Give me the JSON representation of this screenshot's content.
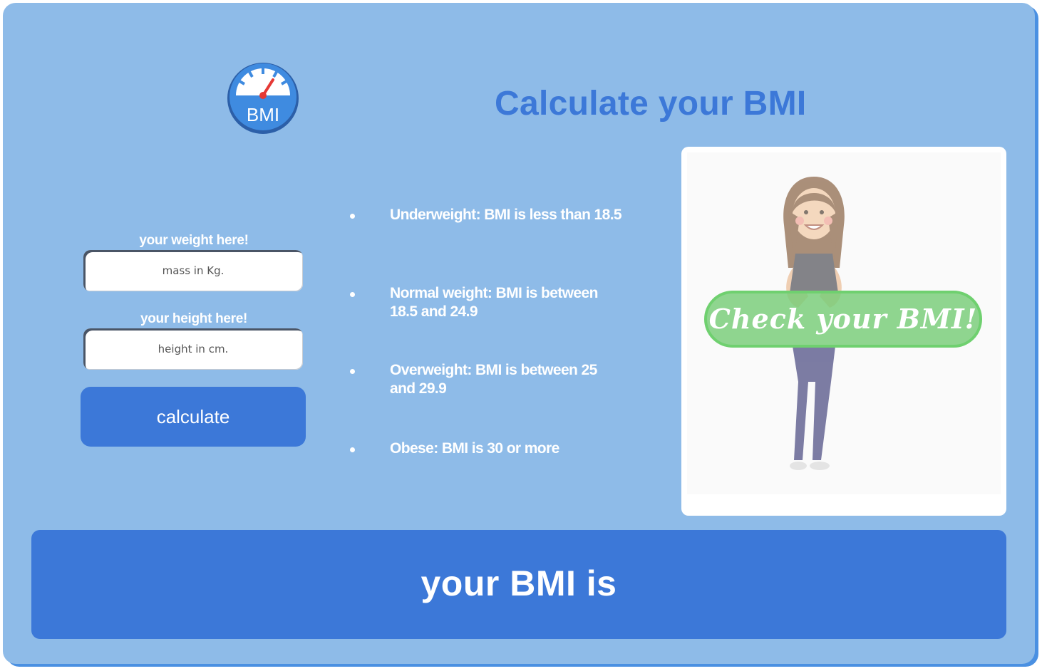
{
  "header": {
    "logo_text": "BMI",
    "title": "Calculate your BMI"
  },
  "form": {
    "weight_label": "your weight here!",
    "weight_placeholder": "mass in Kg.",
    "height_label": "your height here!",
    "height_placeholder": "height in cm.",
    "calculate_label": "calculate"
  },
  "categories": [
    "Underweight: BMI is less than 18.5",
    "Normal weight: BMI is between 18.5 and 24.9",
    "Overweight: BMI is between 25 and 29.9",
    "Obese: BMI is 30 or more"
  ],
  "promo": {
    "banner_text": "Check your BMI!",
    "illustration_icon": "smiling-woman-illustration"
  },
  "result": {
    "label": "your BMI is"
  },
  "colors": {
    "background": "#8ebbe8",
    "accent": "#3c78d8",
    "banner_green": "#78cd78",
    "gauge_red": "#e53935"
  }
}
